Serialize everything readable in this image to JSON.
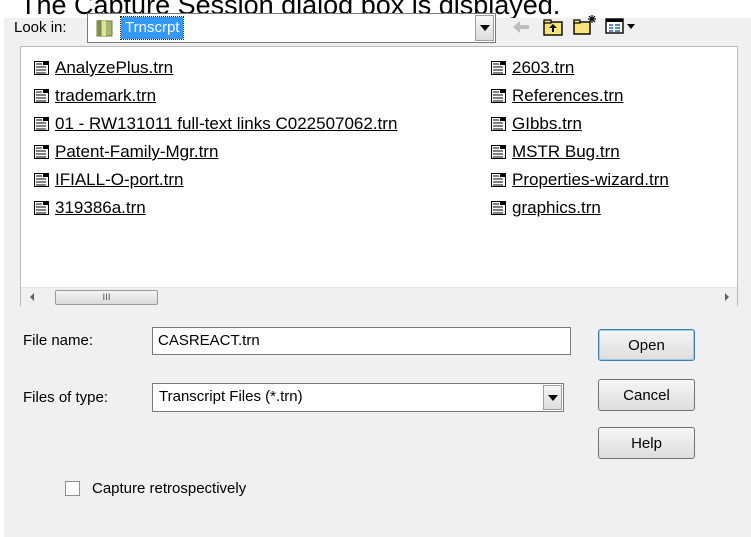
{
  "caption": "The Capture Session dialog box is displayed.",
  "look_in": {
    "label": "Look in:",
    "value": "Trnscrpt"
  },
  "toolbar": {
    "icons": [
      "back-arrow-icon",
      "up-folder-icon",
      "new-folder-icon",
      "view-menu-icon"
    ]
  },
  "files": {
    "left": [
      "AnalyzePlus.trn",
      "trademark.trn",
      "01 - RW131011 full-text links C022507062.trn",
      "Patent-Family-Mgr.trn",
      "IFIALL-O-port.trn",
      "319386a.trn"
    ],
    "right": [
      "2603.trn",
      "References.trn",
      "GIbbs.trn",
      "MSTR Bug.trn",
      "Properties-wizard.trn",
      "graphics.trn"
    ]
  },
  "file_name": {
    "label": "File name:",
    "value": "CASREACT.trn"
  },
  "file_type": {
    "label": "Files of type:",
    "value": "Transcript Files (*.trn)"
  },
  "buttons": {
    "open": "Open",
    "cancel": "Cancel",
    "help": "Help"
  },
  "capture": {
    "label": "Capture retrospectively",
    "checked": false
  },
  "scrollbar": {
    "grip": "III"
  }
}
